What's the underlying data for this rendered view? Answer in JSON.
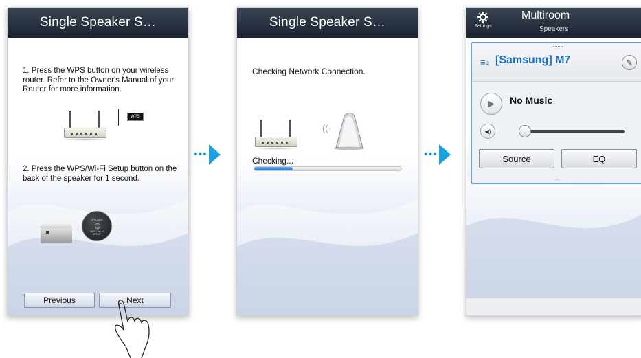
{
  "panel1": {
    "title": "Single Speaker S…",
    "step1": "1. Press the WPS button on your wireless router. Refer to the Owner's Manual of your Router for more information.",
    "wps_label": "WPS",
    "step2": "2. Press the WPS/Wi-Fi Setup button on the back of the speaker for 1 second.",
    "speaker_btn_top": "SPK ADD",
    "speaker_btn_label": "WPS / WI-FI SETUP",
    "previous_label": "Previous",
    "next_label": "Next"
  },
  "panel2": {
    "title": "Single Speaker S…",
    "message": "Checking Network Connection.",
    "status": "Checking...",
    "progress": 0.26
  },
  "panel3": {
    "title": "Multiroom",
    "subtitle": "Speakers",
    "settings_label": "Settings",
    "speaker_name": "[Samsung] M7",
    "now_playing": "No Music",
    "volume": 0.04,
    "source_label": "Source",
    "eq_label": "EQ"
  },
  "colors": {
    "title_bar": "#1f2633",
    "accent_blue": "#1f70c1",
    "arrow": "#1aa3e0"
  },
  "icons": [
    "router-icon",
    "wps-button-icon",
    "speaker-icon",
    "hand-icon",
    "settings-icon",
    "speaker-list-icon",
    "pencil-icon",
    "play-icon",
    "volume-icon",
    "arrow-icon"
  ]
}
